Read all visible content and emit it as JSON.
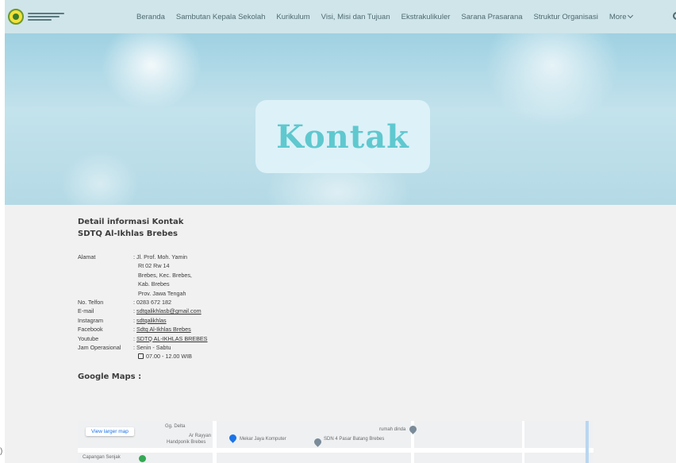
{
  "header": {
    "nav": [
      "Beranda",
      "Sambutan Kepala Sekolah",
      "Kurikulum",
      "Visi, Misi dan Tujuan",
      "Ekstrakulikuler",
      "Sarana Prasarana",
      "Struktur Organisasi"
    ],
    "more_label": "More"
  },
  "hero": {
    "title": "Kontak"
  },
  "contact": {
    "heading_line1": "Detail informasi Kontak",
    "heading_line2": "SDTQ Al-Ikhlas  Brebes",
    "alamat_label": "Alamat",
    "alamat_lines": [
      ": Jl. Prof. Moh. Yamin",
      "Rt 02 Rw 14",
      "Brebes, Kec. Brebes,",
      "Kab. Brebes",
      "Prov. Jawa Tengah"
    ],
    "telfon_label": "No. Telfon",
    "telfon_value": ": 0283 672 182",
    "email_label": "E-mail",
    "email_value": "sdtqalikhlasb@gmail.com",
    "instagram_label": "Instagram",
    "instagram_value": "sdtqalikhlas",
    "facebook_label": "Facebook",
    "facebook_value": "Sdtq Al-Ikhlas Brebes",
    "youtube_label": "Youtube",
    "youtube_value": "SDTQ AL-IKHLAS BREBES",
    "jam_label": "Jam Operasional",
    "jam_days": ": Senin - Sabtu",
    "jam_hours": "07.00 - 12.00 WIB"
  },
  "maps": {
    "heading": "Google Maps :",
    "view_larger": "View larger map",
    "labels": [
      "Gg. Delta",
      "Ar Rayyan",
      "Mekar Jaya Komputer",
      "SDN 4 Pasar Batang Brebes",
      "rumah dinda",
      "Capangan Senjak",
      "Handponik Brebes"
    ]
  },
  "colors": {
    "header_bg": "#cfe5ea",
    "hero_title": "#5fc8cf",
    "link_blue": "#1a73e8"
  }
}
